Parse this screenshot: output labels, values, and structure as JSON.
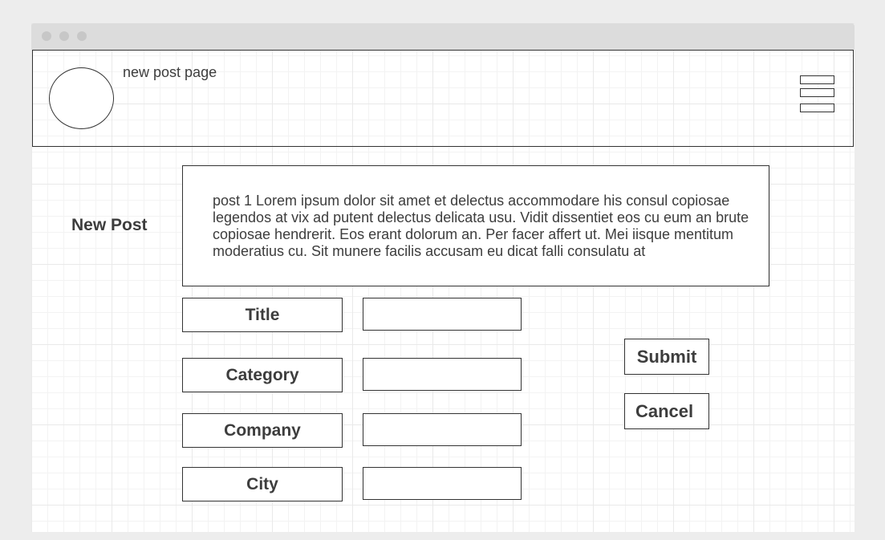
{
  "header": {
    "page_label": "new post page"
  },
  "main": {
    "heading": "New Post",
    "post_body": "post 1 Lorem ipsum dolor sit amet et delectus accommodare his consul copiosae legendos at vix ad putent delectus delicata usu. Vidit dissentiet eos cu eum an brute copiosae hendrerit. Eos erant dolorum an. Per facer affert ut. Mei iisque mentitum moderatius cu. Sit munere facilis accusam eu dicat falli consulatu at"
  },
  "form": {
    "fields": [
      {
        "label": "Title",
        "value": ""
      },
      {
        "label": "Category",
        "value": ""
      },
      {
        "label": "Company",
        "value": ""
      },
      {
        "label": "City",
        "value": ""
      }
    ],
    "submit_label": "Submit",
    "cancel_label": "Cancel"
  },
  "icons": {
    "avatar": "avatar-placeholder",
    "menu": "hamburger-menu-icon"
  },
  "colors": {
    "border": "#333333",
    "text": "#3d3d3d",
    "window_chrome": "#dcdcdc",
    "background": "#ededed"
  }
}
